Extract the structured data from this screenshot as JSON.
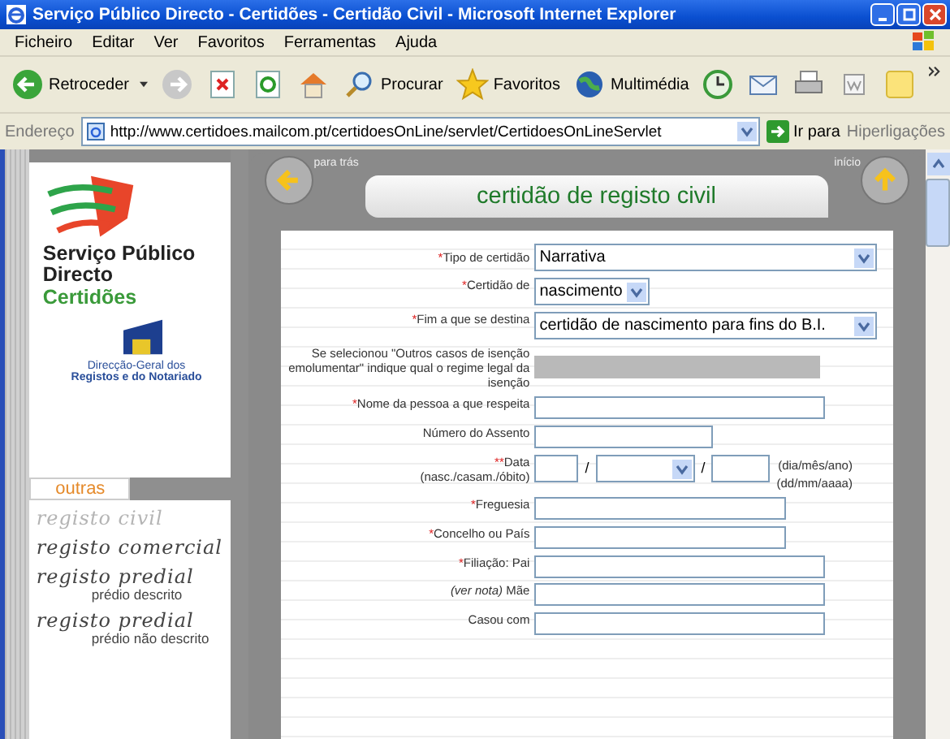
{
  "window": {
    "title": "Serviço Público Directo - Certidões - Certidão Civil - Microsoft Internet Explorer"
  },
  "menu_bar": [
    "Ficheiro",
    "Editar",
    "Ver",
    "Favoritos",
    "Ferramentas",
    "Ajuda"
  ],
  "toolbar": [
    {
      "kind": "back",
      "label": "Retroceder"
    },
    {
      "kind": "forward"
    },
    {
      "kind": "stop"
    },
    {
      "kind": "refresh"
    },
    {
      "kind": "home"
    },
    {
      "kind": "search",
      "label": "Procurar"
    },
    {
      "kind": "favorites",
      "label": "Favoritos"
    },
    {
      "kind": "media",
      "label": "Multimédia"
    },
    {
      "kind": "history"
    },
    {
      "kind": "mail"
    },
    {
      "kind": "print"
    },
    {
      "kind": "edit"
    },
    {
      "kind": "note"
    }
  ],
  "address_bar": {
    "label": "Endereço",
    "url": "http://www.certidoes.mailcom.pt/certidoesOnLine/servlet/CertidoesOnLineServlet",
    "go": "Ir para",
    "links": "Hiperligações"
  },
  "sidebar": {
    "logo_lines": [
      "Serviço Público",
      "Directo"
    ],
    "logo_sub": "Certidões",
    "agency_lines": [
      "Direcção-Geral dos",
      "Registos e do Notariado"
    ],
    "tab": "outras",
    "links": [
      {
        "title": "registo civil",
        "active": false
      },
      {
        "title": "registo comercial",
        "active": true
      },
      {
        "title": "registo predial",
        "sub": "prédio descrito",
        "active": true
      },
      {
        "title": "registo predial",
        "sub": "prédio não descrito",
        "active": true
      }
    ]
  },
  "nav": {
    "back": "para trás",
    "home": "início"
  },
  "heading": "certidão de registo civil",
  "form": [
    {
      "kind": "select",
      "mark": "*",
      "label": "Tipo de certidão",
      "value": "Narrativa"
    },
    {
      "kind": "select-short",
      "mark": "*",
      "label": "Certidão de",
      "value": "nascimento"
    },
    {
      "kind": "select",
      "mark": "*",
      "label": "Fim a que se destina",
      "value": "certidão de nascimento para fins do B.I."
    },
    {
      "kind": "readonly",
      "label": "Se selecionou \"Outros casos de isenção emolumentar\" indique qual o regime legal da isenção"
    },
    {
      "kind": "text",
      "mark": "*",
      "label": "Nome da pessoa a que respeita"
    },
    {
      "kind": "text-short",
      "label": "Número do Assento"
    },
    {
      "kind": "date",
      "mark": "**",
      "label": "Data",
      "sublabel": "(nasc./casam./óbito)",
      "sep": "/",
      "hint": "(dia/mês/ano)",
      "hint2": "(dd/mm/aaaa)"
    },
    {
      "kind": "text-medium",
      "mark": "*",
      "label": "Freguesia"
    },
    {
      "kind": "text-medium",
      "mark": "*",
      "label": "Concelho ou País"
    },
    {
      "kind": "parents",
      "mark": "*",
      "label": "Filiação: Pai",
      "note": "(ver nota)",
      "label2": "Mãe"
    },
    {
      "kind": "text",
      "label": "Casou com"
    }
  ]
}
